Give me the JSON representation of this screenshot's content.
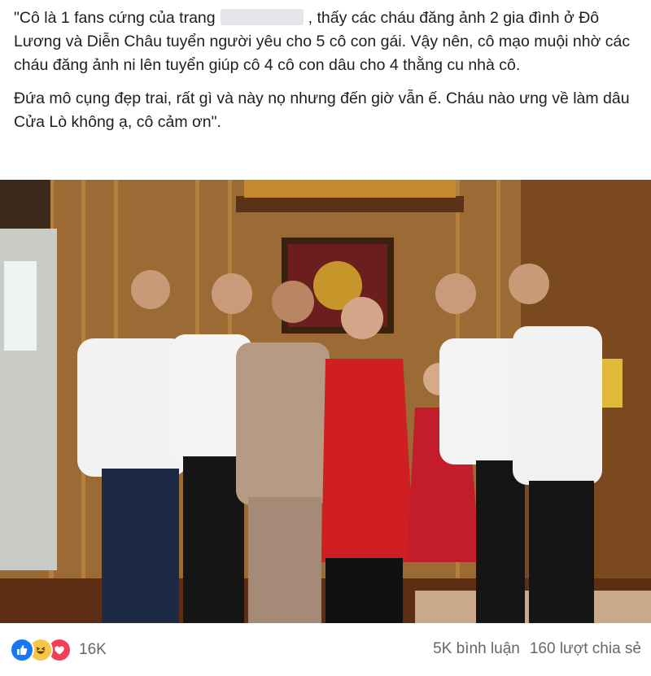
{
  "post": {
    "line1_a": "\"Cô là 1 fans cứng của trang",
    "line1_b": ", thấy các cháu đăng ảnh 2 gia đình ở Đô Lương và Diễn Châu tuyển người yêu cho 5 cô con gái. Vậy nên, cô mạo muội nhờ các cháu đăng ảnh ni lên tuyển giúp cô 4 cô con dâu cho 4 thằng cu nhà cô.",
    "paragraph2": "Đứa mô cụng đẹp trai, rất gì và này nọ nhưng đến giờ vẫn ế. Cháu nào ưng về làm dâu Cửa Lò không ạ, cô cảm ơn\"."
  },
  "reactions": {
    "icons": [
      "like-icon",
      "haha-icon",
      "love-icon"
    ],
    "count": "16K"
  },
  "stats": {
    "comments": "5K bình luận",
    "shares": "160 lượt chia sẻ"
  },
  "colors": {
    "like": "#1877f2",
    "haha": "#f7c548",
    "love": "#f33e58",
    "muted_text": "#65676b"
  }
}
